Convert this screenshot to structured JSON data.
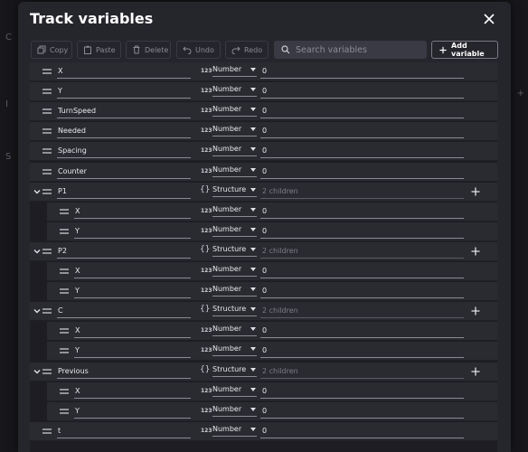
{
  "dialog": {
    "title": "Track variables",
    "close_icon": "close-icon"
  },
  "toolbar": {
    "copy": "Copy",
    "paste": "Paste",
    "delete": "Delete",
    "undo": "Undo",
    "redo": "Redo",
    "search_placeholder": "Search variables",
    "add": "Add variable"
  },
  "colors": {
    "dialog_bg": "#25252c",
    "row_bg": "#2a2a31",
    "text": "#e8e8ec",
    "muted": "#7d7d88"
  },
  "variables": [
    {
      "name": "X",
      "type": "Number",
      "value": "0"
    },
    {
      "name": "Y",
      "type": "Number",
      "value": "0"
    },
    {
      "name": "TurnSpeed",
      "type": "Number",
      "value": "0"
    },
    {
      "name": "Needed",
      "type": "Number",
      "value": "0"
    },
    {
      "name": "Spacing",
      "type": "Number",
      "value": "0"
    },
    {
      "name": "Counter",
      "type": "Number",
      "value": "0"
    },
    {
      "name": "P1",
      "type": "Structure",
      "value": "2 children",
      "children": [
        {
          "name": "X",
          "type": "Number",
          "value": "0"
        },
        {
          "name": "Y",
          "type": "Number",
          "value": "0"
        }
      ]
    },
    {
      "name": "P2",
      "type": "Structure",
      "value": "2 children",
      "children": [
        {
          "name": "X",
          "type": "Number",
          "value": "0"
        },
        {
          "name": "Y",
          "type": "Number",
          "value": "0"
        }
      ]
    },
    {
      "name": "C",
      "type": "Structure",
      "value": "2 children",
      "children": [
        {
          "name": "X",
          "type": "Number",
          "value": "0"
        },
        {
          "name": "Y",
          "type": "Number",
          "value": "0"
        }
      ]
    },
    {
      "name": "Previous",
      "type": "Structure",
      "value": "2 children",
      "children": [
        {
          "name": "X",
          "type": "Number",
          "value": "0"
        },
        {
          "name": "Y",
          "type": "Number",
          "value": "0"
        }
      ]
    },
    {
      "name": "t",
      "type": "Number",
      "value": "0"
    }
  ],
  "type_icons": {
    "Number": "123",
    "Structure": "{}"
  }
}
